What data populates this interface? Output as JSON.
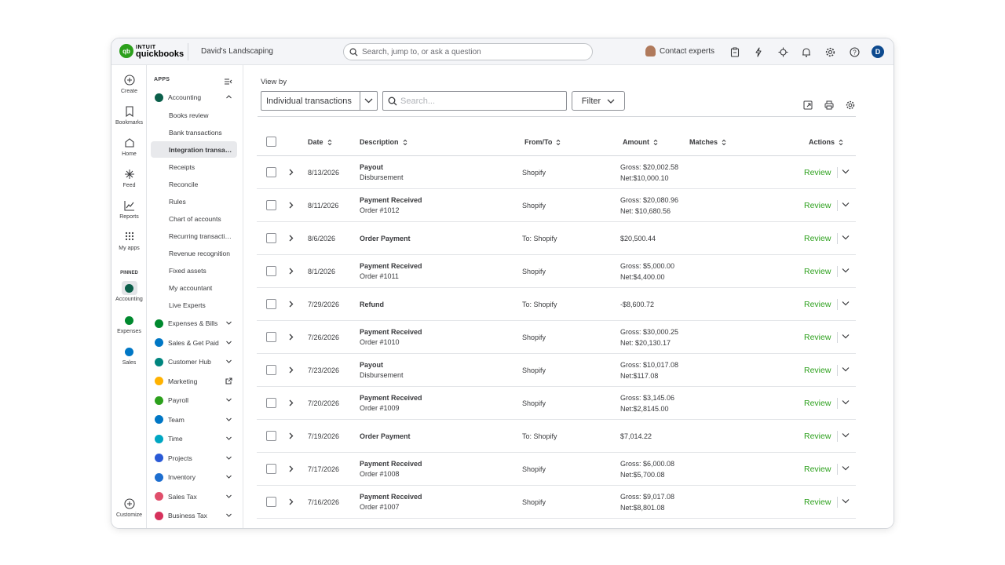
{
  "topbar": {
    "logo_brand": "INTUIT",
    "logo_product": "quickbooks",
    "company_name": "David's Landscaping",
    "search_placeholder": "Search, jump to, or ask a question",
    "contact_label": "Contact experts",
    "user_initial": "D"
  },
  "rail": {
    "create": "Create",
    "bookmarks": "Bookmarks",
    "home": "Home",
    "feed": "Feed",
    "reports": "Reports",
    "my_apps": "My apps",
    "pinned_label": "PINNED",
    "pinned": [
      "Accounting",
      "Expenses",
      "Sales"
    ],
    "customize": "Customize"
  },
  "sidebar": {
    "apps_label": "APPS",
    "accounting_label": "Accounting",
    "accounting_subitems": [
      "Books review",
      "Bank transactions",
      "Integration transactions",
      "Receipts",
      "Reconcile",
      "Rules",
      "Chart of accounts",
      "Recurring transactions",
      "Revenue recognition",
      "Fixed assets",
      "My accountant",
      "Live Experts"
    ],
    "active_subitem": "Integration transactions",
    "apps": [
      {
        "label": "Expenses & Bills",
        "color": "#00892e"
      },
      {
        "label": "Sales & Get Paid",
        "color": "#0077c5"
      },
      {
        "label": "Customer Hub",
        "color": "#00857e"
      },
      {
        "label": "Marketing",
        "color": "#ffb200"
      },
      {
        "label": "Payroll",
        "color": "#2ca01c"
      },
      {
        "label": "Team",
        "color": "#0077c5"
      },
      {
        "label": "Time",
        "color": "#00a6c2"
      },
      {
        "label": "Projects",
        "color": "#2a5ad6"
      },
      {
        "label": "Inventory",
        "color": "#1e6ecf"
      },
      {
        "label": "Sales Tax",
        "color": "#e04f6b"
      },
      {
        "label": "Business Tax",
        "color": "#d6325c"
      }
    ]
  },
  "main": {
    "view_by_label": "View by",
    "view_by_value": "Individual transactions",
    "search_placeholder": "Search...",
    "filter_label": "Filter",
    "columns": {
      "date": "Date",
      "description": "Description",
      "from_to": "From/To",
      "amount": "Amount",
      "matches": "Matches",
      "actions": "Actions"
    },
    "action_label": "Review",
    "rows": [
      {
        "date": "8/13/2026",
        "desc_title": "Payout",
        "desc_sub": "Disbursement",
        "from_to": "Shopify",
        "amount_1": "Gross: $20,002.58",
        "amount_2": "Net:$10,000.10"
      },
      {
        "date": "8/11/2026",
        "desc_title": "Payment Received",
        "desc_sub": "Order #1012",
        "from_to": "Shopify",
        "amount_1": "Gross: $20,080.96",
        "amount_2": "Net: $10,680.56"
      },
      {
        "date": "8/6/2026",
        "desc_title": "Order Payment",
        "desc_sub": "",
        "from_to": "To: Shopify",
        "amount_1": "$20,500.44",
        "amount_2": ""
      },
      {
        "date": "8/1/2026",
        "desc_title": "Payment Received",
        "desc_sub": "Order #1011",
        "from_to": "Shopify",
        "amount_1": "Gross: $5,000.00",
        "amount_2": "Net:$4,400.00"
      },
      {
        "date": "7/29/2026",
        "desc_title": "Refund",
        "desc_sub": "",
        "from_to": "To: Shopify",
        "amount_1": "-$8,600.72",
        "amount_2": ""
      },
      {
        "date": "7/26/2026",
        "desc_title": "Payment Received",
        "desc_sub": "Order #1010",
        "from_to": "Shopify",
        "amount_1": "Gross: $30,000.25",
        "amount_2": "Net: $20,130.17"
      },
      {
        "date": "7/23/2026",
        "desc_title": "Payout",
        "desc_sub": "Disbursement",
        "from_to": "Shopify",
        "amount_1": "Gross: $10,017.08",
        "amount_2": "Net:$117.08"
      },
      {
        "date": "7/20/2026",
        "desc_title": "Payment Received",
        "desc_sub": "Order #1009",
        "from_to": "Shopify",
        "amount_1": "Gross: $3,145.06",
        "amount_2": "Net:$2,8145.00"
      },
      {
        "date": "7/19/2026",
        "desc_title": "Order Payment",
        "desc_sub": "",
        "from_to": "To: Shopify",
        "amount_1": "$7,014.22",
        "amount_2": ""
      },
      {
        "date": "7/17/2026",
        "desc_title": "Payment Received",
        "desc_sub": "Order #1008",
        "from_to": "Shopify",
        "amount_1": "Gross: $6,000.08",
        "amount_2": "Net:$5,700.08"
      },
      {
        "date": "7/16/2026",
        "desc_title": "Payment Received",
        "desc_sub": "Order #1007",
        "from_to": "Shopify",
        "amount_1": "Gross: $9,017.08",
        "amount_2": "Net:$8,801.08"
      }
    ]
  },
  "colors": {
    "brand_green": "#2ca01c",
    "accounting_dot": "#0b5f4a",
    "expenses_dot": "#00892e",
    "sales_dot": "#0077c5"
  }
}
